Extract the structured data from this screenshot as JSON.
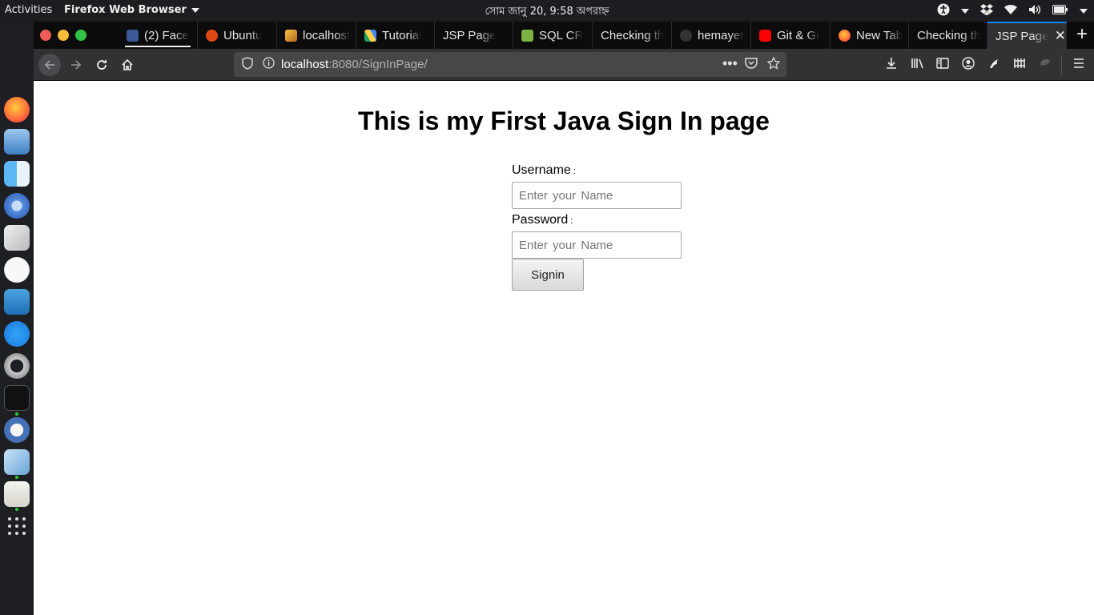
{
  "topbar": {
    "activities": "Activities",
    "app_menu": "Firefox Web Browser",
    "clock": "সোম জানু 20,  9:58 অপরাহ্ন",
    "tray_icons": [
      "accessibility-icon",
      "dropbox-icon",
      "wifi-icon",
      "volume-icon",
      "battery-icon"
    ]
  },
  "dock": {
    "apps": [
      "firefox",
      "mail",
      "finder",
      "chromium",
      "photos",
      "music",
      "word",
      "app-store",
      "help",
      "terminal",
      "gimp",
      "virtualbox",
      "text-editor",
      "show-applications"
    ]
  },
  "tabs": [
    {
      "label": "(2) Face",
      "favicon": "facebook-icon",
      "color": "#3b5998"
    },
    {
      "label": "Ubuntu",
      "favicon": "askubuntu-icon",
      "color": "#dd4814"
    },
    {
      "label": "localhost",
      "favicon": "tomcat-icon",
      "color": "#d8a93b"
    },
    {
      "label": "Tutorial",
      "favicon": "google-drive-icon",
      "color": "#1fa463"
    },
    {
      "label": "JSP Page",
      "favicon": "",
      "color": ""
    },
    {
      "label": "SQL CR",
      "favicon": "sql-icon",
      "color": "#7cb342"
    },
    {
      "label": "Checking th",
      "favicon": "",
      "color": ""
    },
    {
      "label": "hemayet",
      "favicon": "github-icon",
      "color": "#333333"
    },
    {
      "label": "Git & Gi",
      "favicon": "youtube-icon",
      "color": "#ff0000"
    },
    {
      "label": "New Tab",
      "favicon": "firefox-icon",
      "color": "#ff7139"
    },
    {
      "label": "Checking th",
      "favicon": "",
      "color": ""
    },
    {
      "label": "JSP Page",
      "favicon": "",
      "color": ""
    }
  ],
  "urlbar": {
    "host": "localhost",
    "path": ":8080/SignInPage/"
  },
  "page": {
    "heading": "This is my First Java Sign In page",
    "username_label": "Username",
    "username_placeholder": "Enter your Name",
    "password_label": "Password",
    "password_placeholder": "Enter your Name",
    "colon": ":",
    "signin_label": "Signin"
  },
  "colors": {
    "accent": "#0a84ff",
    "tabstrip_bg": "#0c0c0d",
    "toolbar_bg": "#323234"
  }
}
